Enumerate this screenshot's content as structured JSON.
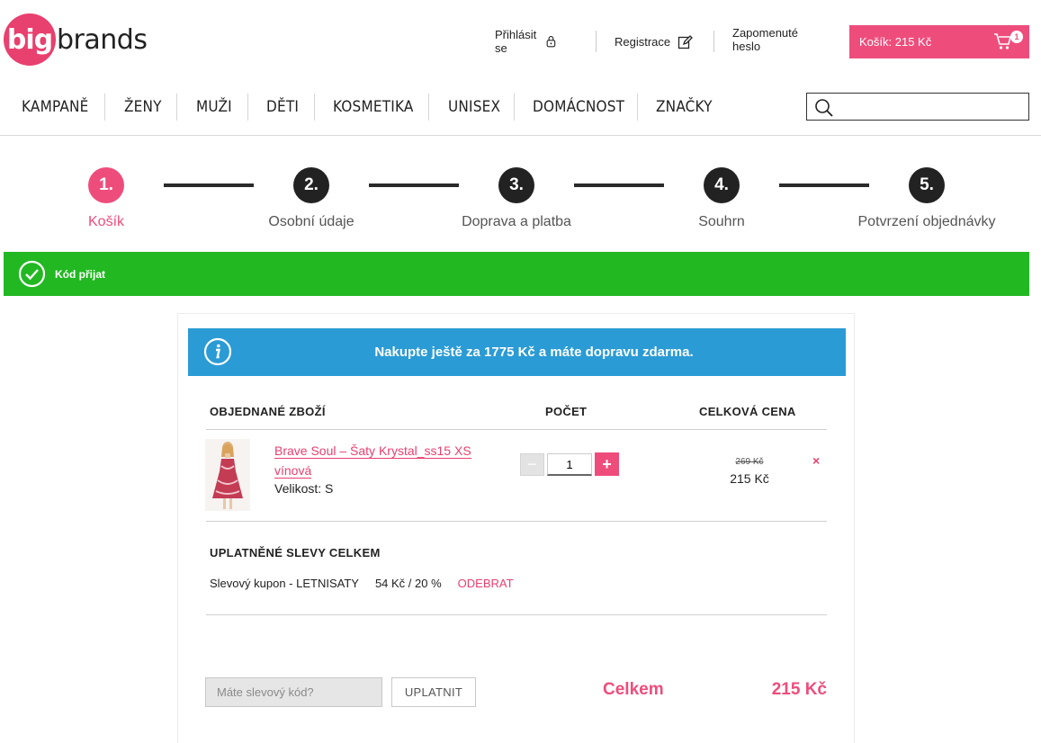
{
  "brand": {
    "logo_circle": "big",
    "logo_text": "brands",
    "accent": "#ee4d7c"
  },
  "header": {
    "login": "Přihlásit se",
    "register": "Registrace",
    "forgot_password": "Zapomenuté heslo",
    "cart_label": "Košík: 215 Kč",
    "cart_count": "1"
  },
  "nav": {
    "items": [
      "KAMPANĚ",
      "ŽENY",
      "MUŽI",
      "DĚTI",
      "KOSMETIKA",
      "UNISEX",
      "DOMÁCNOST",
      "ZNAČKY"
    ],
    "search_placeholder": ""
  },
  "steps": [
    {
      "number": "1.",
      "label": "Košík",
      "active": true
    },
    {
      "number": "2.",
      "label": "Osobní údaje",
      "active": false
    },
    {
      "number": "3.",
      "label": "Doprava a platba",
      "active": false
    },
    {
      "number": "4.",
      "label": "Souhrn",
      "active": false
    },
    {
      "number": "5.",
      "label": "Potvrzení objednávky",
      "active": false
    }
  ],
  "success_message": "Kód přijat",
  "info_message": "Nakupte ještě za 1775 Kč a máte dopravu zdarma.",
  "table": {
    "col_items": "OBJEDNANÉ ZBOŽÍ",
    "col_qty": "POČET",
    "col_price": "CELKOVÁ CENA"
  },
  "item": {
    "name_line1": "Brave Soul – Šaty Krystal_ss15 XS",
    "name_line2": "vínová",
    "size": "Velikost: S",
    "quantity": "1",
    "price_old": "269 Kč",
    "price_new": "215 Kč",
    "remove_icon": "×"
  },
  "discounts": {
    "title": "UPLATNĚNÉ SLEVY CELKEM",
    "coupon": "Slevový kupon - LETNISATY",
    "amount": "54 Kč / 20 %",
    "remove": "ODEBRAT"
  },
  "footer": {
    "coupon_placeholder": "Máte slevový kód?",
    "apply": "UPLATNIT",
    "total_label": "Celkem",
    "total_value": "215 Kč"
  }
}
